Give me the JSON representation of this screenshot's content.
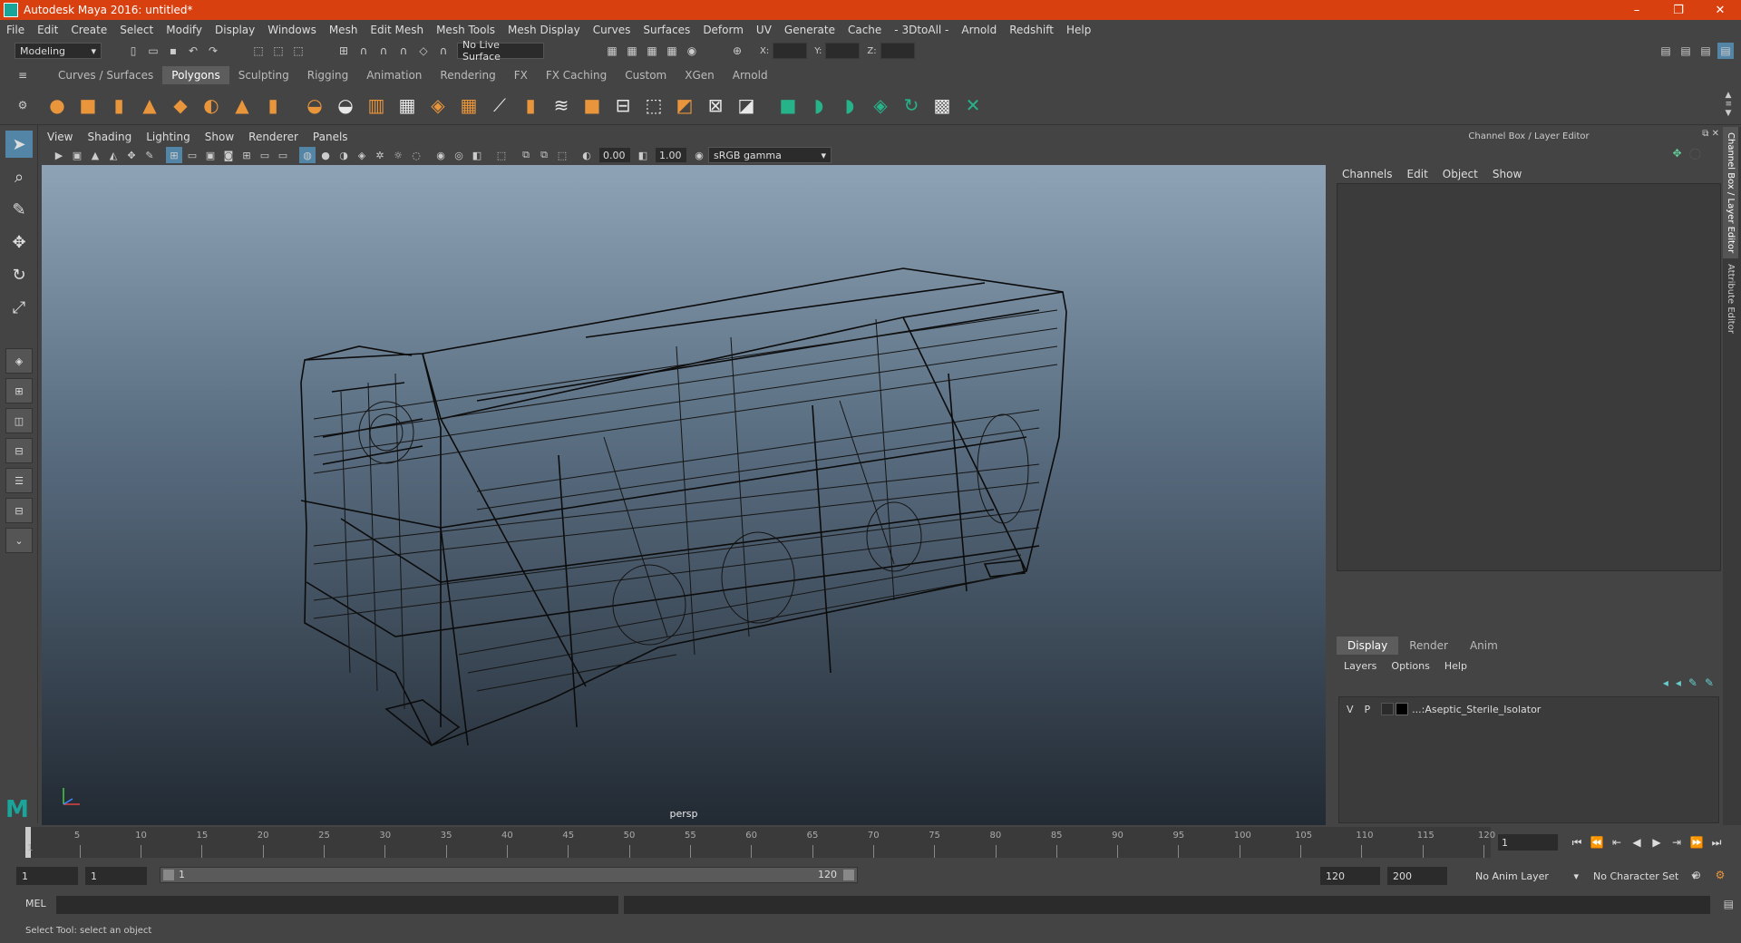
{
  "title": "Autodesk Maya 2016: untitled*",
  "window_controls": [
    "–",
    "❐",
    "✕"
  ],
  "menus": [
    "File",
    "Edit",
    "Create",
    "Select",
    "Modify",
    "Display",
    "Windows",
    "Mesh",
    "Edit Mesh",
    "Mesh Tools",
    "Mesh Display",
    "Curves",
    "Surfaces",
    "Deform",
    "UV",
    "Generate",
    "Cache",
    "- 3DtoAll -",
    "Arnold",
    "Redshift",
    "Help"
  ],
  "status_line": {
    "mode": "Modeling",
    "live_surface": "No Live Surface",
    "x_label": "X:",
    "y_label": "Y:",
    "z_label": "Z:"
  },
  "shelf_tabs": [
    "Curves / Surfaces",
    "Polygons",
    "Sculpting",
    "Rigging",
    "Animation",
    "Rendering",
    "FX",
    "FX Caching",
    "Custom",
    "XGen",
    "Arnold"
  ],
  "active_shelf_tab": "Polygons",
  "viewport": {
    "menus": [
      "View",
      "Shading",
      "Lighting",
      "Show",
      "Renderer",
      "Panels"
    ],
    "exposure": "0.00",
    "gamma": "1.00",
    "color_space": "sRGB gamma",
    "camera": "persp"
  },
  "channel_box": {
    "title": "Channel Box / Layer Editor",
    "menus": [
      "Channels",
      "Edit",
      "Object",
      "Show"
    ]
  },
  "layer_editor": {
    "tabs": [
      "Display",
      "Render",
      "Anim"
    ],
    "active_tab": "Display",
    "menus": [
      "Layers",
      "Options",
      "Help"
    ],
    "layers": [
      {
        "v": "V",
        "p": "P",
        "name": "...:Aseptic_Sterile_Isolator"
      }
    ]
  },
  "side_tabs": [
    "Channel Box / Layer Editor",
    "Attribute Editor"
  ],
  "timeline": {
    "ticks": [
      "5",
      "10",
      "15",
      "20",
      "25",
      "30",
      "35",
      "40",
      "45",
      "50",
      "55",
      "60",
      "65",
      "70",
      "75",
      "80",
      "85",
      "90",
      "95",
      "100",
      "105",
      "110",
      "115",
      "120"
    ],
    "start_label": "1",
    "current_frame": "1"
  },
  "range": {
    "start": "1",
    "playback_start": "1",
    "bar_start": "1",
    "bar_end": "120",
    "playback_end": "120",
    "end": "200",
    "anim_layer": "No Anim Layer",
    "character_set": "No Character Set"
  },
  "command_line": {
    "label": "MEL"
  },
  "help_line": "Select Tool: select an object"
}
